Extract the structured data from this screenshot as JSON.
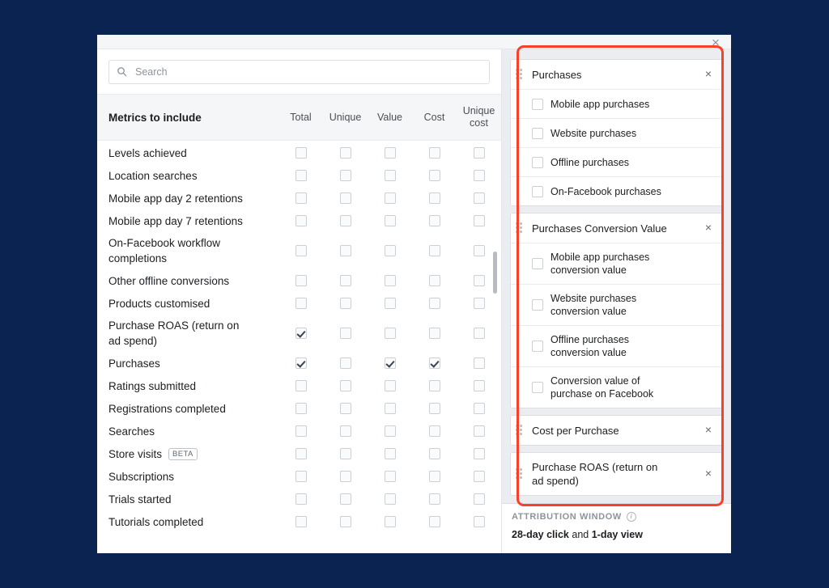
{
  "background_color": "#0b2350",
  "annotation_color": "#f8402a",
  "dialog": {
    "close_label": "×"
  },
  "search": {
    "placeholder": "Search",
    "value": "",
    "icon": "search-icon"
  },
  "table": {
    "title": "Metrics to include",
    "columns": [
      "Total",
      "Unique",
      "Value",
      "Cost",
      "Unique\ncost"
    ],
    "rows": [
      {
        "label": "Levels achieved",
        "checks": [
          false,
          false,
          false,
          false,
          false
        ]
      },
      {
        "label": "Location searches",
        "checks": [
          false,
          false,
          false,
          false,
          false
        ]
      },
      {
        "label": "Mobile app day 2 retentions",
        "checks": [
          false,
          false,
          false,
          false,
          false
        ]
      },
      {
        "label": "Mobile app day 7 retentions",
        "checks": [
          false,
          false,
          false,
          false,
          false
        ]
      },
      {
        "label": "On-Facebook workflow\ncompletions",
        "checks": [
          false,
          false,
          false,
          false,
          false
        ]
      },
      {
        "label": "Other offline conversions",
        "checks": [
          false,
          false,
          false,
          false,
          false
        ]
      },
      {
        "label": "Products customised",
        "checks": [
          false,
          false,
          false,
          false,
          false
        ]
      },
      {
        "label": "Purchase ROAS (return on\nad spend)",
        "checks": [
          true,
          false,
          false,
          false,
          false
        ]
      },
      {
        "label": "Purchases",
        "checks": [
          true,
          false,
          true,
          true,
          false
        ]
      },
      {
        "label": "Ratings submitted",
        "checks": [
          false,
          false,
          false,
          false,
          false
        ]
      },
      {
        "label": "Registrations completed",
        "checks": [
          false,
          false,
          false,
          false,
          false
        ]
      },
      {
        "label": "Searches",
        "checks": [
          false,
          false,
          false,
          false,
          false
        ]
      },
      {
        "label": "Store visits",
        "badge": "BETA",
        "checks": [
          false,
          false,
          false,
          false,
          false
        ]
      },
      {
        "label": "Subscriptions",
        "checks": [
          false,
          false,
          false,
          false,
          false
        ]
      },
      {
        "label": "Trials started",
        "checks": [
          false,
          false,
          false,
          false,
          false
        ]
      },
      {
        "label": "Tutorials completed",
        "checks": [
          false,
          false,
          false,
          false,
          false
        ]
      }
    ]
  },
  "selected": {
    "close_label": "×",
    "cards": [
      {
        "title": "Purchases",
        "items": [
          {
            "label": "Mobile app purchases",
            "checked": false
          },
          {
            "label": "Website purchases",
            "checked": false
          },
          {
            "label": "Offline purchases",
            "checked": false
          },
          {
            "label": "On-Facebook purchases",
            "checked": false
          }
        ]
      },
      {
        "title": "Purchases Conversion Value",
        "items": [
          {
            "label": "Mobile app purchases\nconversion value",
            "checked": false
          },
          {
            "label": "Website purchases\nconversion value",
            "checked": false
          },
          {
            "label": "Offline purchases\nconversion value",
            "checked": false
          },
          {
            "label": "Conversion value of\npurchase on Facebook",
            "checked": false
          }
        ]
      },
      {
        "title": "Cost per Purchase",
        "items": []
      },
      {
        "title": "Purchase ROAS (return on\nad spend)",
        "items": []
      }
    ]
  },
  "attribution": {
    "heading": "ATTRIBUTION WINDOW",
    "info_icon": "info-icon",
    "click_window": "28-day click",
    "conjunction": " and ",
    "view_window": "1-day view"
  }
}
